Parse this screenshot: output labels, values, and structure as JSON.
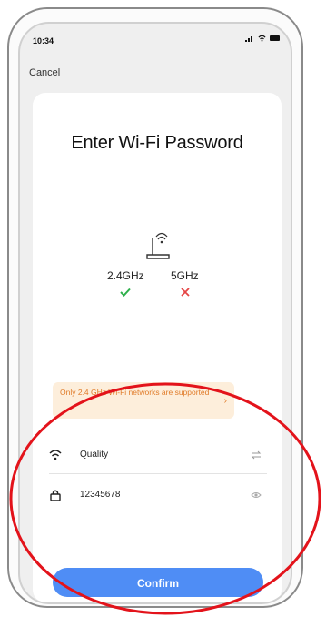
{
  "status_bar": {
    "time": "10:34",
    "icons": [
      "signal-icon",
      "wifi-icon",
      "battery-icon"
    ]
  },
  "nav": {
    "cancel_label": "Cancel"
  },
  "page": {
    "title": "Enter Wi-Fi Password"
  },
  "bands": {
    "band_24_label": "2.4GHz",
    "band_24_supported": true,
    "band_5_label": "5GHz",
    "band_5_supported": false
  },
  "banner": {
    "text": "Only 2.4 GHz Wi-Fi networks are supported",
    "chevron": "›"
  },
  "fields": {
    "network_name": "Quality",
    "password": "12345678"
  },
  "actions": {
    "confirm_label": "Confirm"
  },
  "colors": {
    "accent": "#4f8df5",
    "success": "#2fb04c",
    "error": "#e54545",
    "warning_text": "#e07b29",
    "warning_bg": "#fdeedb",
    "annotation_ring": "#e3131b"
  }
}
